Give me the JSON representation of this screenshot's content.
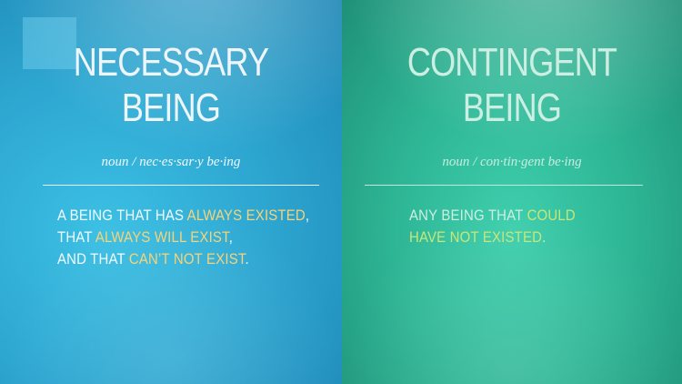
{
  "left": {
    "title_line1": "Necessary",
    "title_line2": "Being",
    "pronunciation": "noun / nec·es·sar·y be·ing",
    "definition": {
      "line1_a": "A being that has ",
      "line1_hl": "always existed",
      "line1_b": ",",
      "line2_a": "that ",
      "line2_hl": "always will exist",
      "line2_b": ",",
      "line3_a": "and that ",
      "line3_hl": "can’t not exist",
      "line3_b": "."
    },
    "colors": {
      "background": "#2ea8d2",
      "highlight": "#f7d37a"
    }
  },
  "right": {
    "title_line1": "Contingent",
    "title_line2": "Being",
    "pronunciation": "noun / con·tin·gent be·ing",
    "definition": {
      "line1_a": "Any being that ",
      "line1_hl": "could",
      "line2_hl": "have not existed",
      "line2_b": "."
    },
    "colors": {
      "background": "#2db594",
      "highlight": "#c8e77a"
    }
  }
}
